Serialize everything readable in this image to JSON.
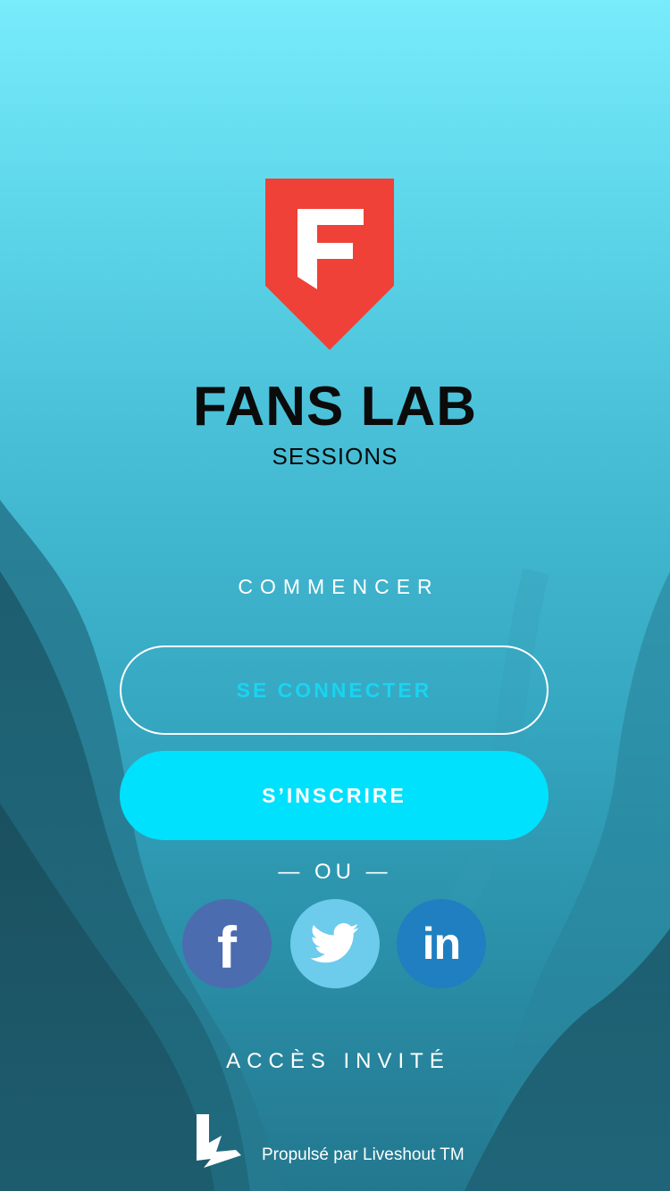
{
  "brand": {
    "logo_letter": "F",
    "title": "FANS LAB",
    "subtitle": "SESSIONS",
    "logo_color": "#ef4137"
  },
  "onboarding": {
    "start_label": "COMMENCER",
    "login_label": "SE CONNECTER",
    "signup_label": "S’INSCRIRE",
    "or_label": "— OU —",
    "guest_label": "ACCÈS INVITÉ"
  },
  "social": [
    {
      "name": "facebook",
      "icon": "facebook-icon",
      "glyph": "f",
      "color": "#4c6cb0"
    },
    {
      "name": "twitter",
      "icon": "twitter-bird-icon",
      "color": "#6dcbec"
    },
    {
      "name": "linkedin",
      "icon": "linkedin-icon",
      "glyph": "in",
      "color": "#1f7fc1"
    }
  ],
  "footer": {
    "powered_by": "Propulsé par Liveshout TM",
    "logo_icon": "liveshout-logo-icon"
  },
  "colors": {
    "accent": "#00e1fe",
    "login_text": "#19d4f2",
    "text_dark": "#0b0b0b"
  }
}
